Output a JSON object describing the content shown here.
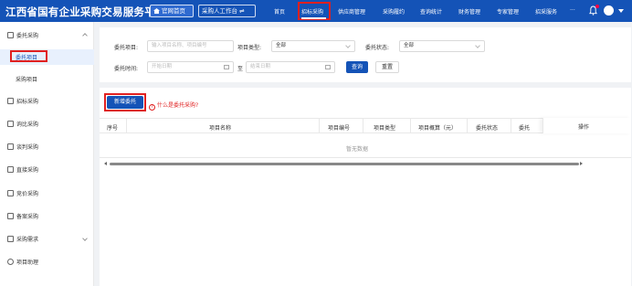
{
  "header": {
    "logo": "江西省国有企业采购交易服务平台",
    "home_button": "官网首页",
    "workbench_button": "采购人工作台 ⇌",
    "nav": [
      "首页",
      "招标采购",
      "供应商管理",
      "采购履约",
      "查询统计",
      "财务管理",
      "专家管理",
      "招采服务",
      "···"
    ],
    "active_nav": "招标采购"
  },
  "sidebar": {
    "group_label": "委托采购",
    "items_sub": [
      "委托项目",
      "采购项目"
    ],
    "items": [
      "招标采购",
      "询比采购",
      "谈判采购",
      "直接采购",
      "竞价采购",
      "备案采购",
      "采购需求",
      "项目助理"
    ]
  },
  "filter": {
    "project_label": "委托项目:",
    "project_placeholder": "输入项目名称、项目编号",
    "type_label": "项目类型:",
    "type_value": "全部",
    "status_label": "委托状态:",
    "status_value": "全部",
    "time_label": "委托时间:",
    "start_placeholder": "开始日期",
    "to": "至",
    "end_placeholder": "结束日期",
    "query": "查询",
    "reset": "重置"
  },
  "table": {
    "new_button": "新增委托",
    "help_link": "什么是委托采购?",
    "columns": [
      "序号",
      "项目名称",
      "项目编号",
      "项目类型",
      "项目概算（元）",
      "委托状态",
      "委托",
      "操作"
    ],
    "empty": "暂无数据"
  },
  "colors": {
    "primary": "#1453b7",
    "highlight": "#e02020"
  }
}
